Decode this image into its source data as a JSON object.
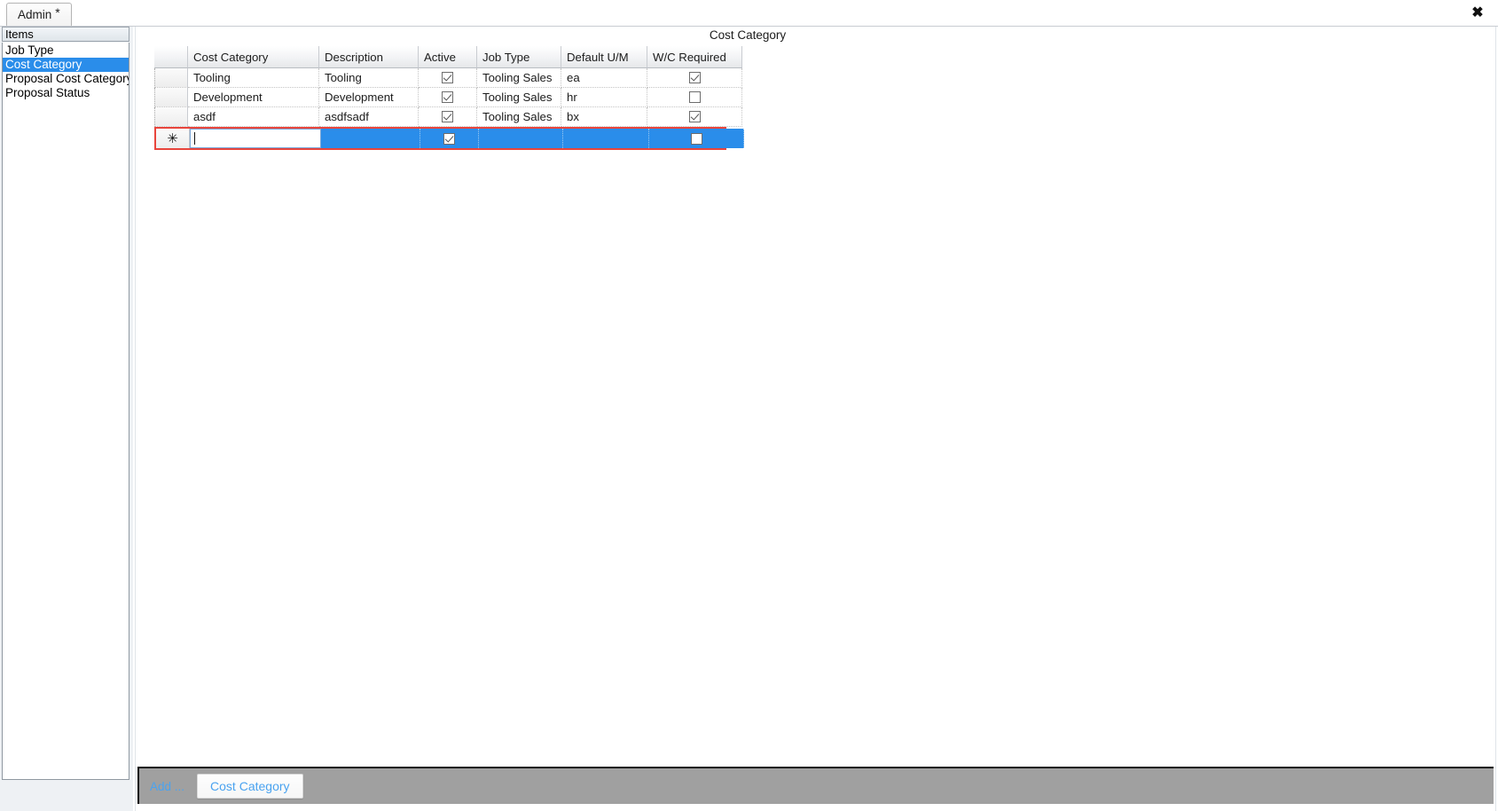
{
  "window": {
    "close_label": "✖"
  },
  "tabs": [
    {
      "label": "Admin",
      "dirty_marker": "*",
      "selected": true
    }
  ],
  "sidebar": {
    "header": "Items",
    "items": [
      {
        "label": "Job Type",
        "selected": false
      },
      {
        "label": "Cost Category",
        "selected": true
      },
      {
        "label": "Proposal Cost Category",
        "selected": false
      },
      {
        "label": "Proposal Status",
        "selected": false
      }
    ]
  },
  "content": {
    "title": "Cost Category"
  },
  "grid": {
    "columns": [
      {
        "key": "name",
        "label": "Cost Category"
      },
      {
        "key": "description",
        "label": "Description"
      },
      {
        "key": "active",
        "label": "Active"
      },
      {
        "key": "job_type",
        "label": "Job Type"
      },
      {
        "key": "default_uom",
        "label": "Default U/M"
      },
      {
        "key": "wc_required",
        "label": "W/C Required"
      }
    ],
    "rows": [
      {
        "name": "Tooling",
        "description": "Tooling",
        "active": true,
        "job_type": "Tooling Sales",
        "default_uom": "ea",
        "wc_required": true
      },
      {
        "name": "Development",
        "description": "Development",
        "active": true,
        "job_type": "Tooling Sales",
        "default_uom": "hr",
        "wc_required": false
      },
      {
        "name": "asdf",
        "description": "asdfsadf",
        "active": true,
        "job_type": "Tooling Sales",
        "default_uom": "bx",
        "wc_required": true
      }
    ],
    "new_row": {
      "marker": "✳",
      "name": "",
      "description": "",
      "active": true,
      "job_type": "",
      "default_uom": "",
      "wc_required": false,
      "editing_column": "name",
      "selected": true
    }
  },
  "toolbar": {
    "add_label": "Add ...",
    "buttons": [
      {
        "label": "Cost Category"
      }
    ]
  },
  "colors": {
    "selection_blue": "#2a8dea",
    "new_row_border_red": "#e8453c",
    "toolbar_gray": "#a0a0a0",
    "link_blue": "#4aa3f0"
  }
}
